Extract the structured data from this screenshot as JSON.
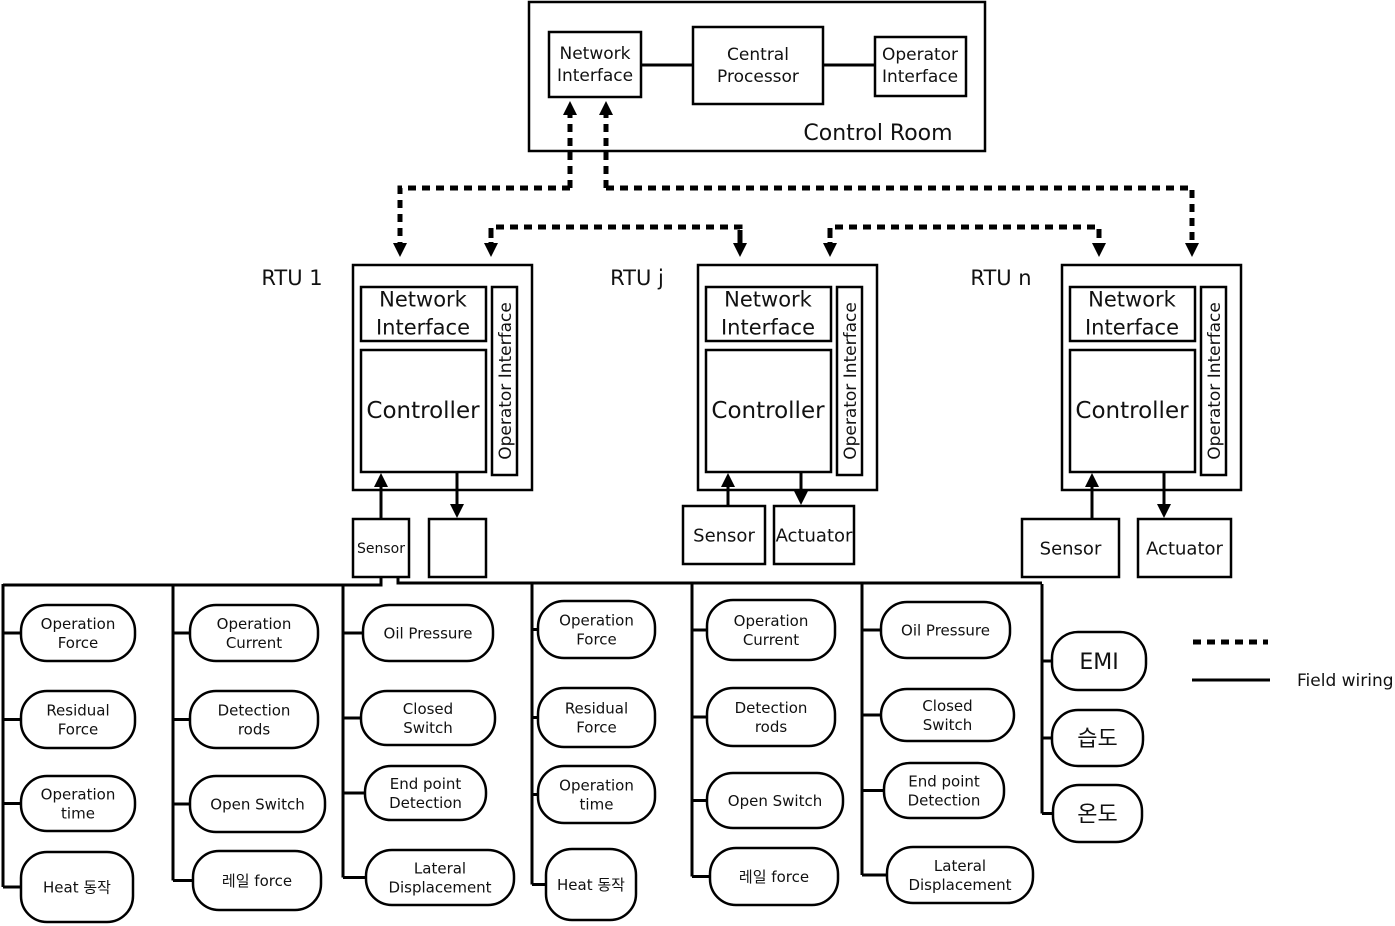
{
  "control_room": {
    "title": "Control Room",
    "network_interface": [
      "Network",
      "Interface"
    ],
    "central_processor": [
      "Central",
      "Processor"
    ],
    "operator_interface": [
      "Operator",
      "Interface"
    ]
  },
  "rtus": [
    {
      "label": "RTU 1",
      "network_interface": [
        "Network",
        "Interface"
      ],
      "controller": "Controller",
      "operator_interface": "Operator Interface",
      "sensor": "Sensor",
      "actuator": ""
    },
    {
      "label": "RTU j",
      "network_interface": [
        "Network",
        "Interface"
      ],
      "controller": "Controller",
      "operator_interface": "Operator Interface",
      "sensor": "Sensor",
      "actuator": "Actuator"
    },
    {
      "label": "RTU n",
      "network_interface": [
        "Network",
        "Interface"
      ],
      "controller": "Controller",
      "operator_interface": "Operator Interface",
      "sensor": "Sensor",
      "actuator": "Actuator"
    }
  ],
  "sensor_groups": [
    {
      "items": [
        [
          "Operation",
          "Force"
        ],
        [
          "Residual",
          "Force"
        ],
        [
          "Operation",
          "time"
        ],
        [
          "Heat 동작"
        ]
      ]
    },
    {
      "items": [
        [
          "Operation",
          "Current"
        ],
        [
          "Detection",
          "rods"
        ],
        [
          "Open Switch"
        ],
        [
          "레일 force"
        ]
      ]
    },
    {
      "items": [
        [
          "Oil Pressure"
        ],
        [
          "Closed",
          "Switch"
        ],
        [
          "End point",
          "Detection"
        ],
        [
          "Lateral",
          "Displacement"
        ]
      ]
    },
    {
      "items": [
        [
          "Operation",
          "Force"
        ],
        [
          "Residual",
          "Force"
        ],
        [
          "Operation",
          "time"
        ],
        [
          "Heat 동작"
        ]
      ]
    },
    {
      "items": [
        [
          "Operation",
          "Current"
        ],
        [
          "Detection",
          "rods"
        ],
        [
          "Open Switch"
        ],
        [
          "레일 force"
        ]
      ]
    },
    {
      "items": [
        [
          "Oil Pressure"
        ],
        [
          "Closed",
          "Switch"
        ],
        [
          "End point",
          "Detection"
        ],
        [
          "Lateral",
          "Displacement"
        ]
      ]
    },
    {
      "items": [
        [
          "EMI"
        ],
        [
          "습도"
        ],
        [
          "온도"
        ]
      ]
    }
  ],
  "legend": {
    "dashed_label": "",
    "solid_label": "Field wiring"
  }
}
